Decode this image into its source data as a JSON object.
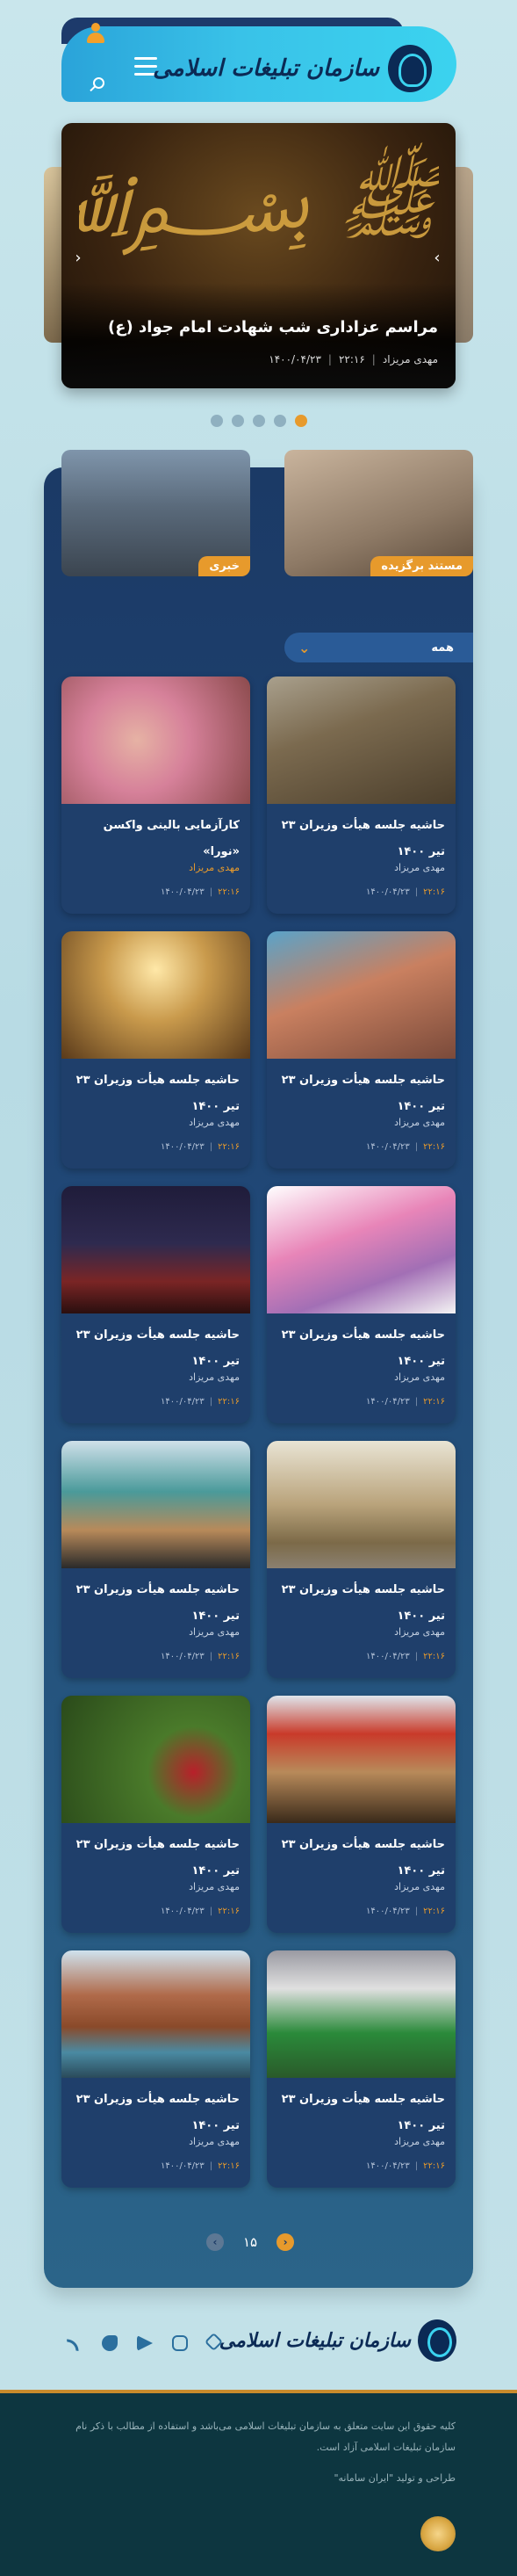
{
  "header": {
    "logo_text": "سازمان تبلیغات اسلامی",
    "icons": [
      "user-icon",
      "search-icon",
      "menu-icon"
    ]
  },
  "slider": {
    "title": "مراسم عزاداری شب شهادت امام جواد (ع)",
    "author": "مهدی مریزاد",
    "time": "۲۲:۱۶",
    "date": "۱۴۰۰/۰۴/۲۳",
    "dots_count": 5,
    "active_dot": 5
  },
  "top_cards": {
    "right_label": "مستند برگزیده",
    "left_label": "خبری"
  },
  "filter": {
    "label": "همه"
  },
  "cards": [
    {
      "title": "حاشیه جلسه هیأت وزیران ۲۳ تیر ۱۴۰۰",
      "author": "مهدی مریزاد",
      "time": "۲۲:۱۶",
      "date": "۱۴۰۰/۰۴/۲۳"
    },
    {
      "title": "کارآزمایی بالینی واکسن «نورا»",
      "author": "مهدی مریزاد",
      "time": "۲۲:۱۶",
      "date": "۱۴۰۰/۰۴/۲۳"
    },
    {
      "title": "حاشیه جلسه هیأت وزیران ۲۳ تیر ۱۴۰۰",
      "author": "مهدی مریزاد",
      "time": "۲۲:۱۶",
      "date": "۱۴۰۰/۰۴/۲۳"
    },
    {
      "title": "حاشیه جلسه هیأت وزیران ۲۳ تیر ۱۴۰۰",
      "author": "مهدی مریزاد",
      "time": "۲۲:۱۶",
      "date": "۱۴۰۰/۰۴/۲۳"
    },
    {
      "title": "حاشیه جلسه هیأت وزیران ۲۳ تیر ۱۴۰۰",
      "author": "مهدی مریزاد",
      "time": "۲۲:۱۶",
      "date": "۱۴۰۰/۰۴/۲۳"
    },
    {
      "title": "حاشیه جلسه هیأت وزیران ۲۳ تیر ۱۴۰۰",
      "author": "مهدی مریزاد",
      "time": "۲۲:۱۶",
      "date": "۱۴۰۰/۰۴/۲۳"
    },
    {
      "title": "حاشیه جلسه هیأت وزیران ۲۳ تیر ۱۴۰۰",
      "author": "مهدی مریزاد",
      "time": "۲۲:۱۶",
      "date": "۱۴۰۰/۰۴/۲۳"
    },
    {
      "title": "حاشیه جلسه هیأت وزیران ۲۳ تیر ۱۴۰۰",
      "author": "مهدی مریزاد",
      "time": "۲۲:۱۶",
      "date": "۱۴۰۰/۰۴/۲۳"
    },
    {
      "title": "حاشیه جلسه هیأت وزیران ۲۳ تیر ۱۴۰۰",
      "author": "مهدی مریزاد",
      "time": "۲۲:۱۶",
      "date": "۱۴۰۰/۰۴/۲۳"
    },
    {
      "title": "حاشیه جلسه هیأت وزیران ۲۳ تیر ۱۴۰۰",
      "author": "مهدی مریزاد",
      "time": "۲۲:۱۶",
      "date": "۱۴۰۰/۰۴/۲۳"
    },
    {
      "title": "حاشیه جلسه هیأت وزیران ۲۳ تیر ۱۴۰۰",
      "author": "مهدی مریزاد",
      "time": "۲۲:۱۶",
      "date": "۱۴۰۰/۰۴/۲۳"
    },
    {
      "title": "حاشیه جلسه هیأت وزیران ۲۳ تیر ۱۴۰۰",
      "author": "مهدی مریزاد",
      "time": "۲۲:۱۶",
      "date": "۱۴۰۰/۰۴/۲۳"
    }
  ],
  "pager": {
    "current": "۱۵"
  },
  "footer": {
    "logo_text": "سازمان تبلیغات اسلامی",
    "copyright": "کلیه حقوق این سایت متعلق به سازمان تبلیغات اسلامی می‌باشد و استفاده از مطالب با ذکر نام سازمان تبلیغات اسلامی آزاد است.",
    "design": "طراحی و تولید \"ایران سامانه\"",
    "social_icons": [
      "rss-icon",
      "twitter-icon",
      "telegram-icon",
      "instagram-icon",
      "aparat-icon"
    ]
  },
  "colors": {
    "accent": "#e79a2c",
    "panel": "#1b3a66",
    "header_gradient_start": "#2aa3d9",
    "header_gradient_end": "#3bd3ef"
  }
}
